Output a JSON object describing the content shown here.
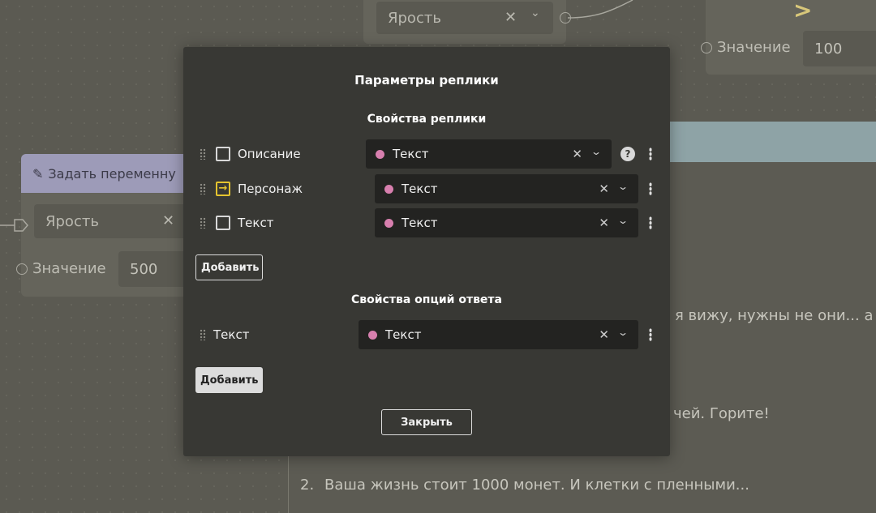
{
  "background": {
    "top_node": {
      "select_value": "Ярость"
    },
    "top_right_node": {
      "operator": ">",
      "value_label": "Значение",
      "value": "100"
    },
    "left_node": {
      "header": "Задать переменну",
      "select_value": "Ярость",
      "value_label": "Значение",
      "value": "500"
    },
    "right_panel": {
      "line1": "я вижу, нужны не они... а",
      "line2": "чей. Горите!",
      "line3_number": "2.",
      "line3": "Ваша жизнь стоит 1000 монет. И клетки с пленными..."
    }
  },
  "modal": {
    "title": "Параметры реплики",
    "replica_section": {
      "title": "Свойства реплики",
      "rows": [
        {
          "label": "Описание",
          "value": "Текст",
          "checkbox": "unchecked",
          "has_help": true
        },
        {
          "label": "Персонаж",
          "value": "Текст",
          "checkbox": "linked"
        },
        {
          "label": "Текст",
          "value": "Текст",
          "checkbox": "unchecked"
        }
      ],
      "add_label": "Добавить"
    },
    "options_section": {
      "title": "Свойства опций ответа",
      "rows": [
        {
          "label": "Текст",
          "value": "Текст"
        }
      ],
      "add_label": "Добавить"
    },
    "close_label": "Закрыть",
    "help_glyph": "?",
    "linked_glyph": "→",
    "clear_glyph": "✕",
    "chevron_glyph": "⌄"
  },
  "colors": {
    "modal_bg": "#383834",
    "select_bg": "#232321",
    "type_dot": "#d77fae",
    "linked_accent": "#e5c42f",
    "node_header": "#9d9bb8",
    "panel_header": "#8ea3a6"
  }
}
